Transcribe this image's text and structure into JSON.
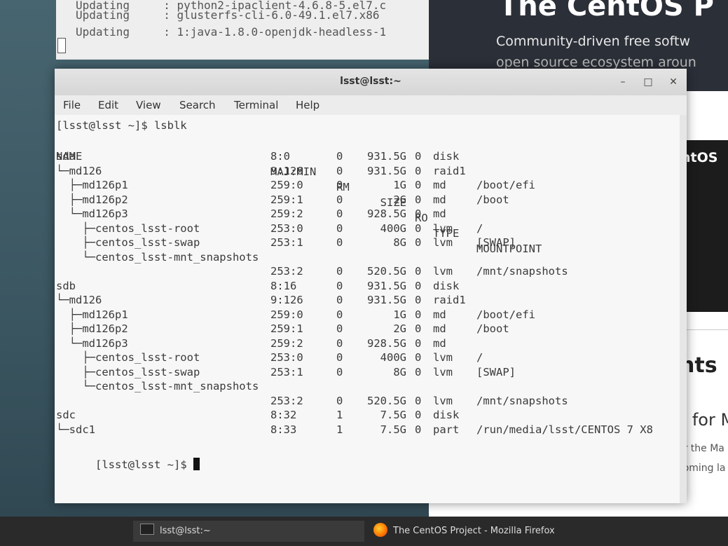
{
  "background_terminal": {
    "lines": [
      "Updating     : python2-ipaclient-4.6.8-5.el7.c",
      "Updating     : glusterfs-cli-6.0-49.1.el7.x86",
      "Updating     : 1:java-1.8.0-openjdk-headless-1"
    ]
  },
  "background_browser": {
    "hero_title": "The CentOS P",
    "hero_subtitle": "Community-driven free softw",
    "hero_subtitle2": "open source ecosystem aroun",
    "card_label": "ntOS",
    "heading": "nts",
    "line_a": "n for M",
    "line_b": "or the Ma",
    "line_c": "coming la"
  },
  "window": {
    "title": "lsst@lsst:~",
    "menu": [
      "File",
      "Edit",
      "View",
      "Search",
      "Terminal",
      "Help"
    ]
  },
  "terminal": {
    "command_line": "[lsst@lsst ~]$ lsblk",
    "headers": {
      "name": "NAME",
      "maj": "MAJ:MIN",
      "rm": "RM",
      "size": "SIZE",
      "ro": "RO",
      "type": "TYPE",
      "mount": "MOUNTPOINT"
    },
    "rows": [
      {
        "name": "sda",
        "maj": "8:0",
        "rm": "0",
        "size": "931.5G",
        "ro": "0",
        "type": "disk",
        "mount": ""
      },
      {
        "name": "└─md126",
        "maj": "9:126",
        "rm": "0",
        "size": "931.5G",
        "ro": "0",
        "type": "raid1",
        "mount": ""
      },
      {
        "name": "  ├─md126p1",
        "maj": "259:0",
        "rm": "0",
        "size": "1G",
        "ro": "0",
        "type": "md",
        "mount": "/boot/efi"
      },
      {
        "name": "  ├─md126p2",
        "maj": "259:1",
        "rm": "0",
        "size": "2G",
        "ro": "0",
        "type": "md",
        "mount": "/boot"
      },
      {
        "name": "  └─md126p3",
        "maj": "259:2",
        "rm": "0",
        "size": "928.5G",
        "ro": "0",
        "type": "md",
        "mount": ""
      },
      {
        "name": "    ├─centos_lsst-root",
        "maj": "253:0",
        "rm": "0",
        "size": "400G",
        "ro": "0",
        "type": "lvm",
        "mount": "/"
      },
      {
        "name": "    ├─centos_lsst-swap",
        "maj": "253:1",
        "rm": "0",
        "size": "8G",
        "ro": "0",
        "type": "lvm",
        "mount": "[SWAP]"
      },
      {
        "name": "    └─centos_lsst-mnt_snapshots",
        "maj": "",
        "rm": "",
        "size": "",
        "ro": "",
        "type": "",
        "mount": ""
      },
      {
        "name": "",
        "maj": "253:2",
        "rm": "0",
        "size": "520.5G",
        "ro": "0",
        "type": "lvm",
        "mount": "/mnt/snapshots"
      },
      {
        "name": "sdb",
        "maj": "8:16",
        "rm": "0",
        "size": "931.5G",
        "ro": "0",
        "type": "disk",
        "mount": ""
      },
      {
        "name": "└─md126",
        "maj": "9:126",
        "rm": "0",
        "size": "931.5G",
        "ro": "0",
        "type": "raid1",
        "mount": ""
      },
      {
        "name": "  ├─md126p1",
        "maj": "259:0",
        "rm": "0",
        "size": "1G",
        "ro": "0",
        "type": "md",
        "mount": "/boot/efi"
      },
      {
        "name": "  ├─md126p2",
        "maj": "259:1",
        "rm": "0",
        "size": "2G",
        "ro": "0",
        "type": "md",
        "mount": "/boot"
      },
      {
        "name": "  └─md126p3",
        "maj": "259:2",
        "rm": "0",
        "size": "928.5G",
        "ro": "0",
        "type": "md",
        "mount": ""
      },
      {
        "name": "    ├─centos_lsst-root",
        "maj": "253:0",
        "rm": "0",
        "size": "400G",
        "ro": "0",
        "type": "lvm",
        "mount": "/"
      },
      {
        "name": "    ├─centos_lsst-swap",
        "maj": "253:1",
        "rm": "0",
        "size": "8G",
        "ro": "0",
        "type": "lvm",
        "mount": "[SWAP]"
      },
      {
        "name": "    └─centos_lsst-mnt_snapshots",
        "maj": "",
        "rm": "",
        "size": "",
        "ro": "",
        "type": "",
        "mount": ""
      },
      {
        "name": "",
        "maj": "253:2",
        "rm": "0",
        "size": "520.5G",
        "ro": "0",
        "type": "lvm",
        "mount": "/mnt/snapshots"
      },
      {
        "name": "sdc",
        "maj": "8:32",
        "rm": "1",
        "size": "7.5G",
        "ro": "0",
        "type": "disk",
        "mount": ""
      },
      {
        "name": "└─sdc1",
        "maj": "8:33",
        "rm": "1",
        "size": "7.5G",
        "ro": "0",
        "type": "part",
        "mount": "/run/media/lsst/CENTOS 7 X8"
      }
    ],
    "final_prompt": "[lsst@lsst ~]$ "
  },
  "taskbar": {
    "items": [
      "lsst@lsst:~",
      "The CentOS Project - Mozilla Firefox"
    ]
  }
}
